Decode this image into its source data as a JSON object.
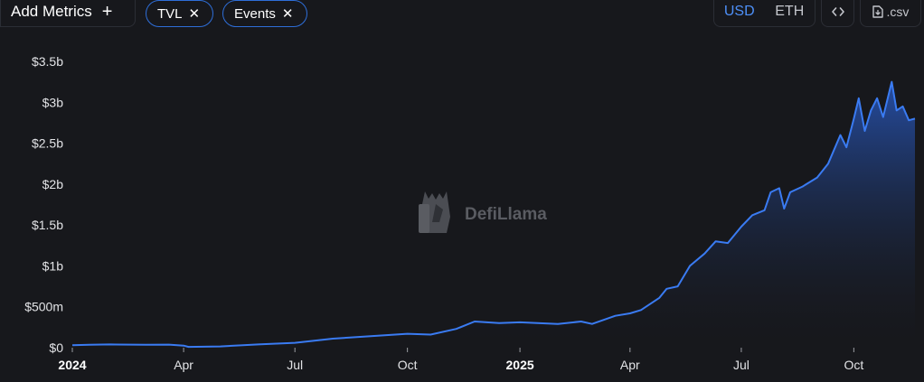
{
  "toolbar": {
    "add_metrics_label": "Add Metrics",
    "chips": [
      {
        "label": "TVL"
      },
      {
        "label": "Events"
      }
    ],
    "currency": {
      "options": [
        "USD",
        "ETH"
      ],
      "selected": "USD"
    },
    "csv_label": ".csv"
  },
  "watermark": "DefiLlama",
  "colors": {
    "line": "#3a7bf2",
    "accent": "#4d8ff7",
    "background": "#17181c"
  },
  "chart_data": {
    "type": "area",
    "x_range": [
      "2024-01-01",
      "2025-11-20"
    ],
    "ylim": [
      0,
      3500000000
    ],
    "y_ticks": [
      "$0",
      "$500m",
      "$1b",
      "$1.5b",
      "$2b",
      "$2.5b",
      "$3b",
      "$3.5b"
    ],
    "x_ticks": [
      {
        "label": "2024",
        "date": "2024-01-01",
        "bold": true
      },
      {
        "label": "Apr",
        "date": "2024-04-01",
        "bold": false
      },
      {
        "label": "Jul",
        "date": "2024-07-01",
        "bold": false
      },
      {
        "label": "Oct",
        "date": "2024-10-01",
        "bold": false
      },
      {
        "label": "2025",
        "date": "2025-01-01",
        "bold": true
      },
      {
        "label": "Apr",
        "date": "2025-04-01",
        "bold": false
      },
      {
        "label": "Jul",
        "date": "2025-07-01",
        "bold": false
      },
      {
        "label": "Oct",
        "date": "2025-10-01",
        "bold": false
      }
    ],
    "series": [
      {
        "values": [
          [
            "2024-01-01",
            30000000
          ],
          [
            "2024-01-15",
            35000000
          ],
          [
            "2024-02-01",
            40000000
          ],
          [
            "2024-03-01",
            35000000
          ],
          [
            "2024-03-20",
            38000000
          ],
          [
            "2024-04-01",
            25000000
          ],
          [
            "2024-04-05",
            10000000
          ],
          [
            "2024-05-01",
            15000000
          ],
          [
            "2024-06-01",
            40000000
          ],
          [
            "2024-07-01",
            60000000
          ],
          [
            "2024-08-01",
            110000000
          ],
          [
            "2024-09-01",
            140000000
          ],
          [
            "2024-10-01",
            170000000
          ],
          [
            "2024-10-20",
            160000000
          ],
          [
            "2024-11-10",
            230000000
          ],
          [
            "2024-11-25",
            320000000
          ],
          [
            "2024-12-15",
            300000000
          ],
          [
            "2025-01-01",
            310000000
          ],
          [
            "2025-02-01",
            290000000
          ],
          [
            "2025-02-20",
            320000000
          ],
          [
            "2025-03-01",
            290000000
          ],
          [
            "2025-03-20",
            390000000
          ],
          [
            "2025-04-01",
            420000000
          ],
          [
            "2025-04-10",
            460000000
          ],
          [
            "2025-04-25",
            610000000
          ],
          [
            "2025-05-01",
            720000000
          ],
          [
            "2025-05-10",
            750000000
          ],
          [
            "2025-05-20",
            1000000000
          ],
          [
            "2025-06-01",
            1150000000
          ],
          [
            "2025-06-10",
            1300000000
          ],
          [
            "2025-06-20",
            1280000000
          ],
          [
            "2025-07-01",
            1480000000
          ],
          [
            "2025-07-10",
            1620000000
          ],
          [
            "2025-07-20",
            1680000000
          ],
          [
            "2025-07-25",
            1900000000
          ],
          [
            "2025-08-01",
            1950000000
          ],
          [
            "2025-08-05",
            1700000000
          ],
          [
            "2025-08-10",
            1900000000
          ],
          [
            "2025-08-20",
            1970000000
          ],
          [
            "2025-09-01",
            2080000000
          ],
          [
            "2025-09-10",
            2250000000
          ],
          [
            "2025-09-20",
            2600000000
          ],
          [
            "2025-09-25",
            2450000000
          ],
          [
            "2025-10-01",
            2800000000
          ],
          [
            "2025-10-05",
            3050000000
          ],
          [
            "2025-10-10",
            2650000000
          ],
          [
            "2025-10-15",
            2900000000
          ],
          [
            "2025-10-20",
            3050000000
          ],
          [
            "2025-10-25",
            2820000000
          ],
          [
            "2025-11-01",
            3250000000
          ],
          [
            "2025-11-05",
            2900000000
          ],
          [
            "2025-11-10",
            2950000000
          ],
          [
            "2025-11-15",
            2780000000
          ],
          [
            "2025-11-20",
            2800000000
          ]
        ]
      }
    ]
  }
}
